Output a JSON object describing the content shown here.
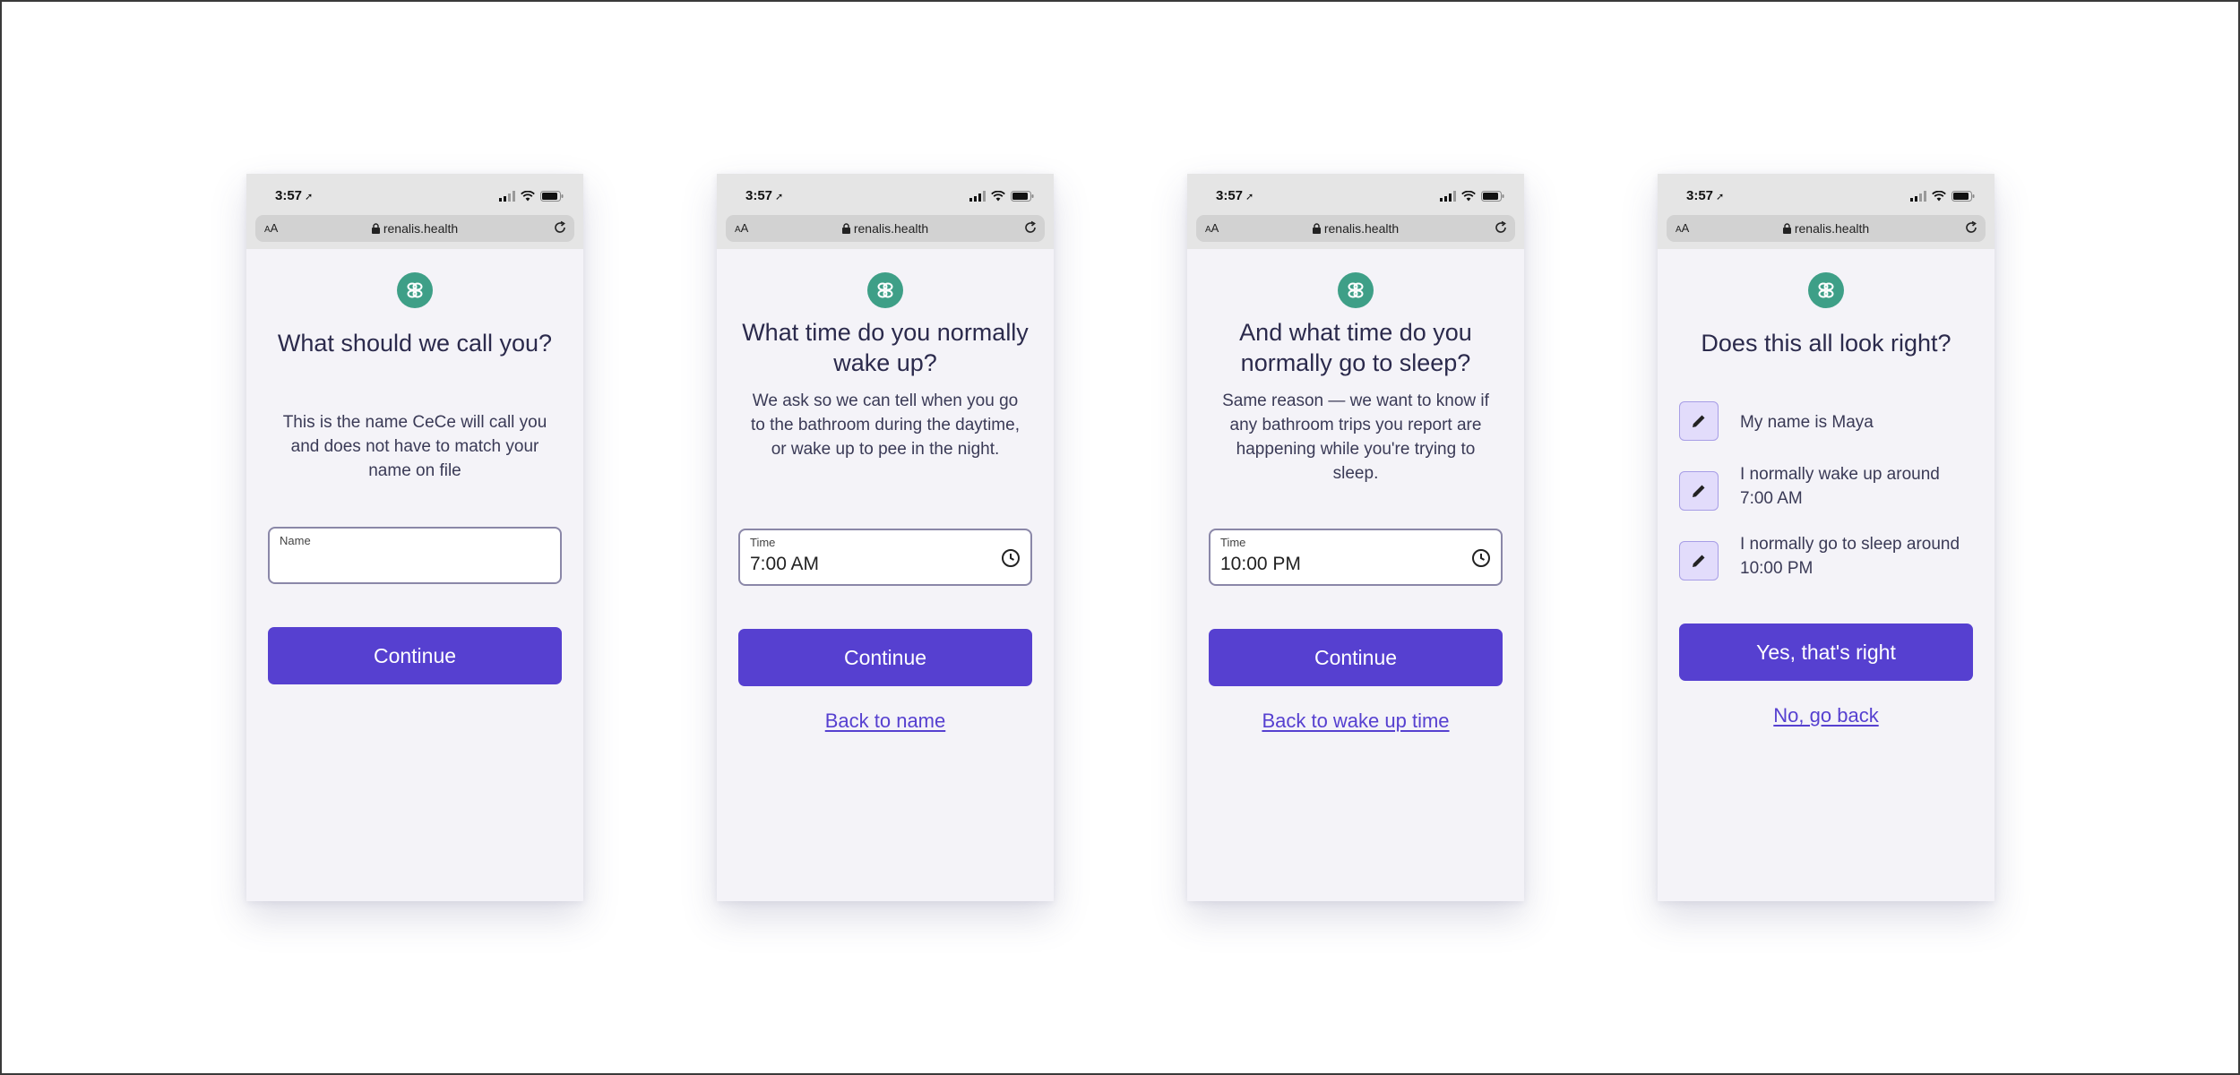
{
  "status_bar": {
    "time": "3:57"
  },
  "browser": {
    "aa_label_small": "A",
    "aa_label_big": "A",
    "url": "renalis.health"
  },
  "screens": {
    "name": {
      "heading": "What should we call you?",
      "description": "This is the name CeCe will call you and does not have to match your name on file",
      "field_label": "Name",
      "field_value": "",
      "continue_label": "Continue"
    },
    "wake": {
      "heading": "What time do you normally wake up?",
      "description": "We ask so we can tell when you go to the bathroom during the daytime, or wake up to pee in the night.",
      "field_label": "Time",
      "field_value": "7:00 AM",
      "continue_label": "Continue",
      "back_label": "Back to name"
    },
    "sleep": {
      "heading": "And what time do you normally go to sleep?",
      "description": "Same reason — we want to know if any bathroom trips you report are happening while you're trying to sleep.",
      "field_label": "Time",
      "field_value": "10:00 PM",
      "continue_label": "Continue",
      "back_label": "Back to wake up time"
    },
    "review": {
      "heading": "Does this all look right?",
      "items": [
        {
          "text": "My name is Maya"
        },
        {
          "text": "I normally wake up around 7:00 AM"
        },
        {
          "text": "I normally go to sleep around 10:00 PM"
        }
      ],
      "confirm_label": "Yes, that's right",
      "back_label": "No, go back"
    }
  },
  "colors": {
    "accent": "#5640d0",
    "logo": "#3e9f87",
    "screen_bg": "#f4f3f8",
    "edit_button_bg": "#e2dcfb"
  },
  "icons": [
    "location-arrow-icon",
    "signal-icon",
    "wifi-icon",
    "battery-icon",
    "lock-icon",
    "reload-icon",
    "logo-icon",
    "clock-icon",
    "pencil-icon"
  ]
}
